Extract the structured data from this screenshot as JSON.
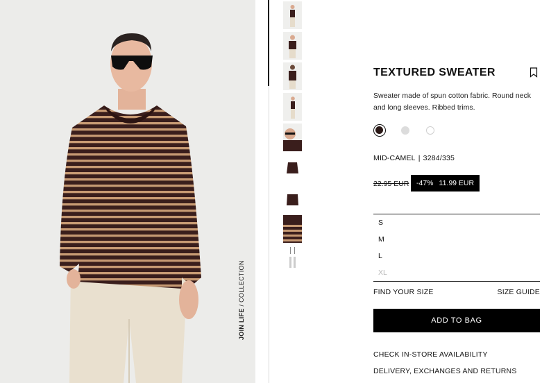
{
  "product": {
    "title": "TEXTURED SWEATER",
    "description": "Sweater made of spun cotton fabric. Round neck and long sleeves. Ribbed trims.",
    "color_name": "MID-CAMEL",
    "separator": "|",
    "reference": "3284/335",
    "old_price": "22.95 EUR",
    "discount": "-47%",
    "sale_price": "11.99 EUR",
    "collection_tag_bold": "JOIN LIFE",
    "collection_tag_rest": " / COLLECTION",
    "colors": [
      {
        "name": "dark-brown",
        "hex": "#3a1e1c",
        "selected": true
      },
      {
        "name": "light-grey",
        "hex": "#dcdcdc",
        "selected": false
      },
      {
        "name": "white",
        "hex": "#ffffff",
        "selected": false
      }
    ]
  },
  "sizes": [
    {
      "label": "S",
      "available": true
    },
    {
      "label": "M",
      "available": true
    },
    {
      "label": "L",
      "available": true
    },
    {
      "label": "XL",
      "available": false
    }
  ],
  "actions": {
    "find_your_size": "FIND YOUR SIZE",
    "size_guide": "SIZE GUIDE",
    "add_to_bag": "ADD TO BAG",
    "check_store": "CHECK IN-STORE AVAILABILITY",
    "delivery": "DELIVERY, EXCHANGES AND RETURNS"
  },
  "icons": {
    "bookmark": "bookmark-icon"
  },
  "colors": {
    "stripe_dark": "#3a1e1c",
    "stripe_light": "#c79a73",
    "accent": "#000000"
  }
}
